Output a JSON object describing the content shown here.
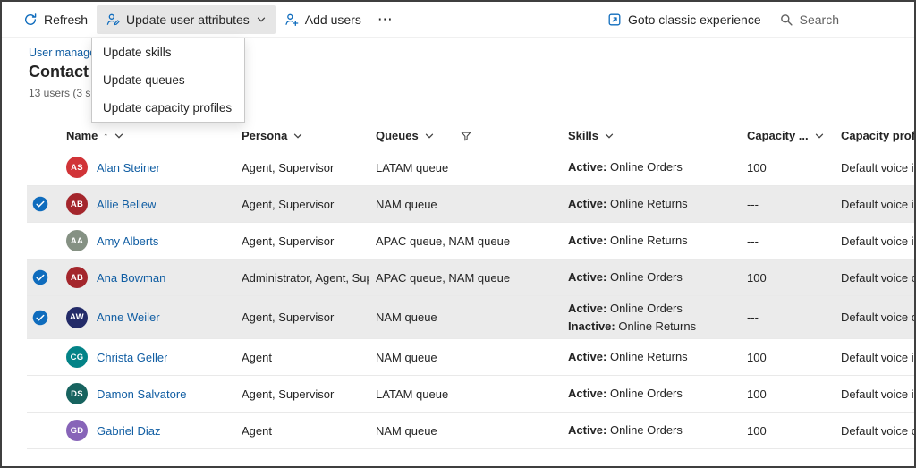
{
  "toolbar": {
    "refresh_label": "Refresh",
    "update_user_attributes_label": "Update user attributes",
    "add_users_label": "Add users",
    "more_label": "⋯",
    "goto_classic_label": "Goto classic experience",
    "search_label": "Search"
  },
  "menu": {
    "items": [
      "Update skills",
      "Update queues",
      "Update capacity profiles"
    ]
  },
  "page": {
    "breadcrumb": "User manage",
    "title": "Contact c",
    "count_text": "13 users (3 s"
  },
  "table": {
    "headers": {
      "name": "Name",
      "persona": "Persona",
      "queues": "Queues",
      "skills": "Skills",
      "capacity": "Capacity ...",
      "capacity_profile": "Capacity profi"
    },
    "sort": {
      "column": "name",
      "direction": "ascending"
    },
    "rows": [
      {
        "selected": false,
        "initials": "AS",
        "avatar_color": "#d13438",
        "name": "Alan Steiner",
        "persona": "Agent, Supervisor",
        "queues": "LATAM queue",
        "skills": [
          {
            "state": "Active",
            "skill": "Online Orders"
          }
        ],
        "capacity": "100",
        "capacity_profile": "Default voice i"
      },
      {
        "selected": true,
        "initials": "AB",
        "avatar_color": "#a4262c",
        "name": "Allie Bellew",
        "persona": "Agent, Supervisor",
        "queues": "NAM queue",
        "skills": [
          {
            "state": "Active",
            "skill": "Online Returns"
          }
        ],
        "capacity": "---",
        "capacity_profile": "Default voice i"
      },
      {
        "selected": false,
        "initials": "AA",
        "avatar_color": "#859183",
        "name": "Amy Alberts",
        "persona": "Agent, Supervisor",
        "queues": "APAC queue, NAM queue",
        "skills": [
          {
            "state": "Active",
            "skill": "Online Returns"
          }
        ],
        "capacity": "---",
        "capacity_profile": "Default voice i"
      },
      {
        "selected": true,
        "initials": "AB",
        "avatar_color": "#a4262c",
        "name": "Ana Bowman",
        "persona": "Administrator, Agent, Sup",
        "queues": "APAC queue, NAM queue",
        "skills": [
          {
            "state": "Active",
            "skill": "Online Orders"
          }
        ],
        "capacity": "100",
        "capacity_profile": "Default voice c"
      },
      {
        "selected": true,
        "initials": "AW",
        "avatar_color": "#232b68",
        "name": "Anne Weiler",
        "persona": "Agent, Supervisor",
        "queues": "NAM queue",
        "skills": [
          {
            "state": "Active",
            "skill": "Online Orders"
          },
          {
            "state": "Inactive",
            "skill": "Online Returns"
          }
        ],
        "capacity": "---",
        "capacity_profile": "Default voice c"
      },
      {
        "selected": false,
        "initials": "CG",
        "avatar_color": "#038387",
        "name": "Christa Geller",
        "persona": "Agent",
        "queues": "NAM queue",
        "skills": [
          {
            "state": "Active",
            "skill": "Online Returns"
          }
        ],
        "capacity": "100",
        "capacity_profile": "Default voice i"
      },
      {
        "selected": false,
        "initials": "DS",
        "avatar_color": "#17635f",
        "name": "Damon Salvatore",
        "persona": "Agent, Supervisor",
        "queues": "LATAM queue",
        "skills": [
          {
            "state": "Active",
            "skill": "Online Orders"
          }
        ],
        "capacity": "100",
        "capacity_profile": "Default voice i"
      },
      {
        "selected": false,
        "initials": "GD",
        "avatar_color": "#8764b8",
        "name": "Gabriel Diaz",
        "persona": "Agent",
        "queues": "NAM queue",
        "skills": [
          {
            "state": "Active",
            "skill": "Online Orders"
          }
        ],
        "capacity": "100",
        "capacity_profile": "Default voice c"
      }
    ]
  },
  "colors": {
    "accent": "#0f6cbd",
    "link": "#115ea3",
    "selected_row_bg": "#ebebeb",
    "window_border": "#3f3f3f"
  }
}
